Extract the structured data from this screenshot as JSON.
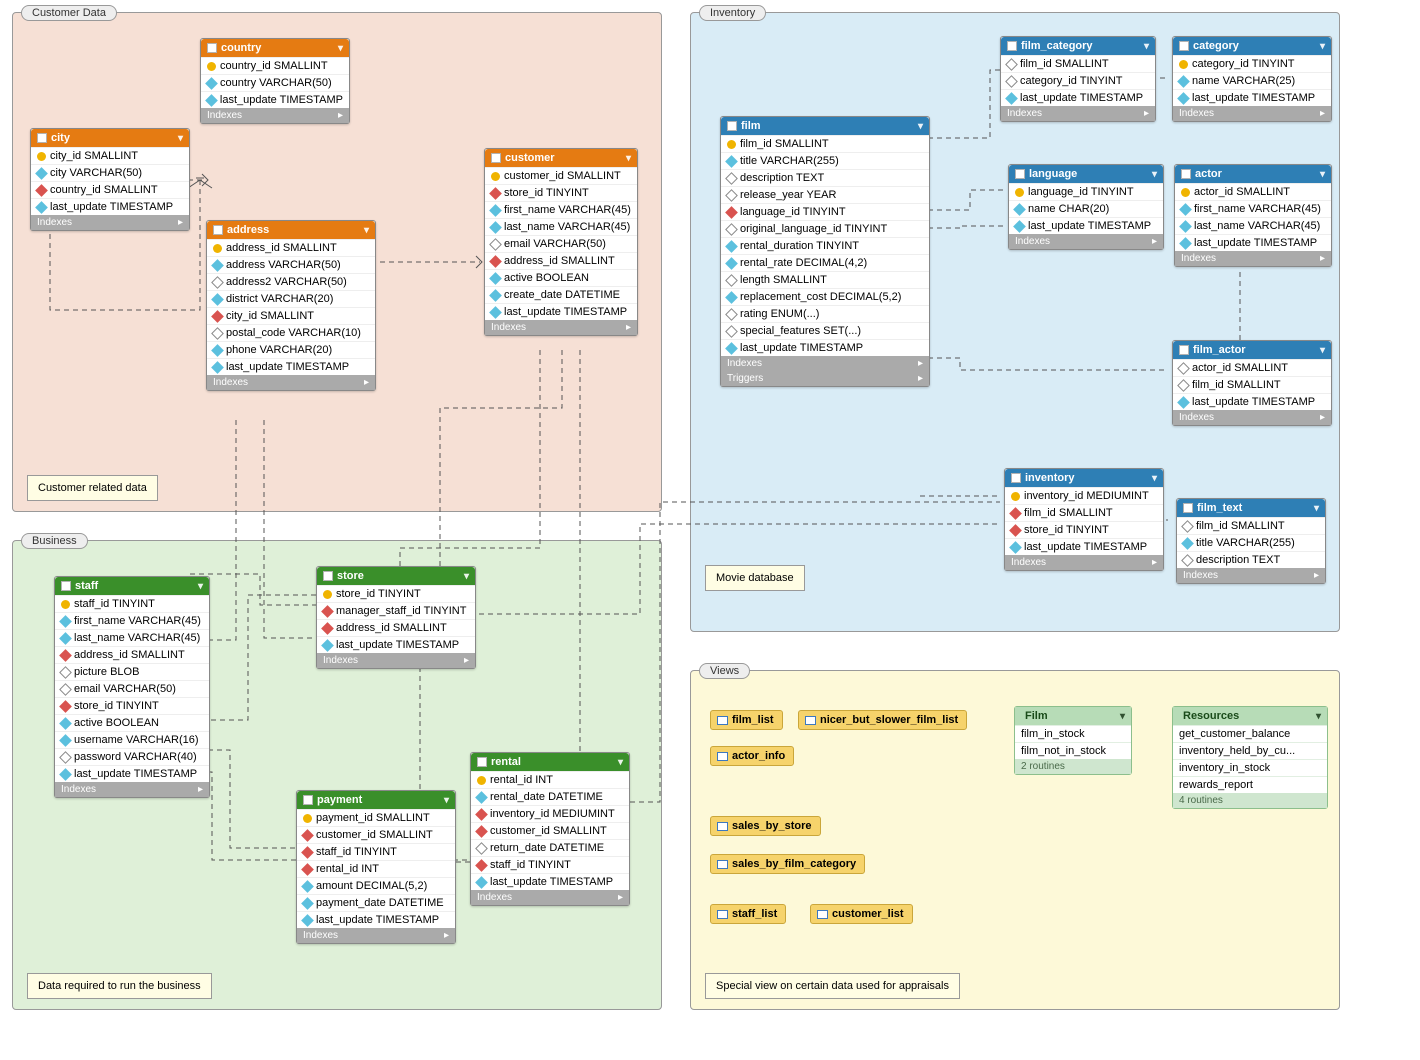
{
  "groups": {
    "customer": {
      "label": "Customer Data",
      "note": "Customer related data"
    },
    "business": {
      "label": "Business",
      "note": "Data required to run the business"
    },
    "inventory": {
      "label": "Inventory",
      "note": "Movie database"
    },
    "views": {
      "label": "Views",
      "note": "Special view on certain data used for appraisals"
    }
  },
  "footer": {
    "indexes": "Indexes",
    "triggers": "Triggers"
  },
  "tables": {
    "country": {
      "title": "country",
      "columns": [
        {
          "icon": "pk",
          "text": "country_id SMALLINT"
        },
        {
          "icon": "idx",
          "text": "country VARCHAR(50)"
        },
        {
          "icon": "idx",
          "text": "last_update TIMESTAMP"
        }
      ]
    },
    "city": {
      "title": "city",
      "columns": [
        {
          "icon": "pk",
          "text": "city_id SMALLINT"
        },
        {
          "icon": "idx",
          "text": "city VARCHAR(50)"
        },
        {
          "icon": "fk",
          "text": "country_id SMALLINT"
        },
        {
          "icon": "idx",
          "text": "last_update TIMESTAMP"
        }
      ]
    },
    "address": {
      "title": "address",
      "columns": [
        {
          "icon": "pk",
          "text": "address_id SMALLINT"
        },
        {
          "icon": "idx",
          "text": "address VARCHAR(50)"
        },
        {
          "icon": "col",
          "text": "address2 VARCHAR(50)"
        },
        {
          "icon": "idx",
          "text": "district VARCHAR(20)"
        },
        {
          "icon": "fk",
          "text": "city_id SMALLINT"
        },
        {
          "icon": "col",
          "text": "postal_code VARCHAR(10)"
        },
        {
          "icon": "idx",
          "text": "phone VARCHAR(20)"
        },
        {
          "icon": "idx",
          "text": "last_update TIMESTAMP"
        }
      ]
    },
    "customer": {
      "title": "customer",
      "columns": [
        {
          "icon": "pk",
          "text": "customer_id SMALLINT"
        },
        {
          "icon": "fk",
          "text": "store_id TINYINT"
        },
        {
          "icon": "idx",
          "text": "first_name VARCHAR(45)"
        },
        {
          "icon": "idx",
          "text": "last_name VARCHAR(45)"
        },
        {
          "icon": "col",
          "text": "email VARCHAR(50)"
        },
        {
          "icon": "fk",
          "text": "address_id SMALLINT"
        },
        {
          "icon": "idx",
          "text": "active BOOLEAN"
        },
        {
          "icon": "idx",
          "text": "create_date DATETIME"
        },
        {
          "icon": "idx",
          "text": "last_update TIMESTAMP"
        }
      ]
    },
    "staff": {
      "title": "staff",
      "columns": [
        {
          "icon": "pk",
          "text": "staff_id TINYINT"
        },
        {
          "icon": "idx",
          "text": "first_name VARCHAR(45)"
        },
        {
          "icon": "idx",
          "text": "last_name VARCHAR(45)"
        },
        {
          "icon": "fk",
          "text": "address_id SMALLINT"
        },
        {
          "icon": "col",
          "text": "picture BLOB"
        },
        {
          "icon": "col",
          "text": "email VARCHAR(50)"
        },
        {
          "icon": "fk",
          "text": "store_id TINYINT"
        },
        {
          "icon": "idx",
          "text": "active BOOLEAN"
        },
        {
          "icon": "idx",
          "text": "username VARCHAR(16)"
        },
        {
          "icon": "col",
          "text": "password VARCHAR(40)"
        },
        {
          "icon": "idx",
          "text": "last_update TIMESTAMP"
        }
      ]
    },
    "store": {
      "title": "store",
      "columns": [
        {
          "icon": "pk",
          "text": "store_id TINYINT"
        },
        {
          "icon": "fk",
          "text": "manager_staff_id TINYINT"
        },
        {
          "icon": "fk",
          "text": "address_id SMALLINT"
        },
        {
          "icon": "idx",
          "text": "last_update TIMESTAMP"
        }
      ]
    },
    "payment": {
      "title": "payment",
      "columns": [
        {
          "icon": "pk",
          "text": "payment_id SMALLINT"
        },
        {
          "icon": "fk",
          "text": "customer_id SMALLINT"
        },
        {
          "icon": "fk",
          "text": "staff_id TINYINT"
        },
        {
          "icon": "fk",
          "text": "rental_id INT"
        },
        {
          "icon": "idx",
          "text": "amount DECIMAL(5,2)"
        },
        {
          "icon": "idx",
          "text": "payment_date DATETIME"
        },
        {
          "icon": "idx",
          "text": "last_update TIMESTAMP"
        }
      ]
    },
    "rental": {
      "title": "rental",
      "columns": [
        {
          "icon": "pk",
          "text": "rental_id INT"
        },
        {
          "icon": "idx",
          "text": "rental_date DATETIME"
        },
        {
          "icon": "fk",
          "text": "inventory_id MEDIUMINT"
        },
        {
          "icon": "fk",
          "text": "customer_id SMALLINT"
        },
        {
          "icon": "col",
          "text": "return_date DATETIME"
        },
        {
          "icon": "fk",
          "text": "staff_id TINYINT"
        },
        {
          "icon": "idx",
          "text": "last_update TIMESTAMP"
        }
      ]
    },
    "film": {
      "title": "film",
      "columns": [
        {
          "icon": "pk",
          "text": "film_id SMALLINT"
        },
        {
          "icon": "idx",
          "text": "title VARCHAR(255)"
        },
        {
          "icon": "col",
          "text": "description TEXT"
        },
        {
          "icon": "col",
          "text": "release_year YEAR"
        },
        {
          "icon": "fk",
          "text": "language_id TINYINT"
        },
        {
          "icon": "col",
          "text": "original_language_id TINYINT"
        },
        {
          "icon": "idx",
          "text": "rental_duration TINYINT"
        },
        {
          "icon": "idx",
          "text": "rental_rate DECIMAL(4,2)"
        },
        {
          "icon": "col",
          "text": "length SMALLINT"
        },
        {
          "icon": "idx",
          "text": "replacement_cost DECIMAL(5,2)"
        },
        {
          "icon": "col",
          "text": "rating ENUM(...)"
        },
        {
          "icon": "col",
          "text": "special_features SET(...)"
        },
        {
          "icon": "idx",
          "text": "last_update TIMESTAMP"
        }
      ]
    },
    "film_category": {
      "title": "film_category",
      "columns": [
        {
          "icon": "col",
          "text": "film_id SMALLINT"
        },
        {
          "icon": "col",
          "text": "category_id TINYINT"
        },
        {
          "icon": "idx",
          "text": "last_update TIMESTAMP"
        }
      ]
    },
    "category": {
      "title": "category",
      "columns": [
        {
          "icon": "pk",
          "text": "category_id TINYINT"
        },
        {
          "icon": "idx",
          "text": "name VARCHAR(25)"
        },
        {
          "icon": "idx",
          "text": "last_update TIMESTAMP"
        }
      ]
    },
    "language": {
      "title": "language",
      "columns": [
        {
          "icon": "pk",
          "text": "language_id TINYINT"
        },
        {
          "icon": "idx",
          "text": "name CHAR(20)"
        },
        {
          "icon": "idx",
          "text": "last_update TIMESTAMP"
        }
      ]
    },
    "actor": {
      "title": "actor",
      "columns": [
        {
          "icon": "pk",
          "text": "actor_id SMALLINT"
        },
        {
          "icon": "idx",
          "text": "first_name VARCHAR(45)"
        },
        {
          "icon": "idx",
          "text": "last_name VARCHAR(45)"
        },
        {
          "icon": "idx",
          "text": "last_update TIMESTAMP"
        }
      ]
    },
    "film_actor": {
      "title": "film_actor",
      "columns": [
        {
          "icon": "col",
          "text": "actor_id SMALLINT"
        },
        {
          "icon": "col",
          "text": "film_id SMALLINT"
        },
        {
          "icon": "idx",
          "text": "last_update TIMESTAMP"
        }
      ]
    },
    "inventory": {
      "title": "inventory",
      "columns": [
        {
          "icon": "pk",
          "text": "inventory_id MEDIUMINT"
        },
        {
          "icon": "fk",
          "text": "film_id SMALLINT"
        },
        {
          "icon": "fk",
          "text": "store_id TINYINT"
        },
        {
          "icon": "idx",
          "text": "last_update TIMESTAMP"
        }
      ]
    },
    "film_text": {
      "title": "film_text",
      "columns": [
        {
          "icon": "col",
          "text": "film_id SMALLINT"
        },
        {
          "icon": "idx",
          "text": "title VARCHAR(255)"
        },
        {
          "icon": "col",
          "text": "description TEXT"
        }
      ]
    }
  },
  "views": {
    "film_list": "film_list",
    "nicer": "nicer_but_slower_film_list",
    "actor_info": "actor_info",
    "sales_by_store": "sales_by_store",
    "sales_by_film_category": "sales_by_film_category",
    "staff_list": "staff_list",
    "customer_list": "customer_list"
  },
  "routines": {
    "film": {
      "title": "Film",
      "items": [
        "film_in_stock",
        "film_not_in_stock"
      ],
      "footer": "2 routines"
    },
    "resources": {
      "title": "Resources",
      "items": [
        "get_customer_balance",
        "inventory_held_by_cu...",
        "inventory_in_stock",
        "rewards_report"
      ],
      "footer": "4 routines"
    }
  }
}
